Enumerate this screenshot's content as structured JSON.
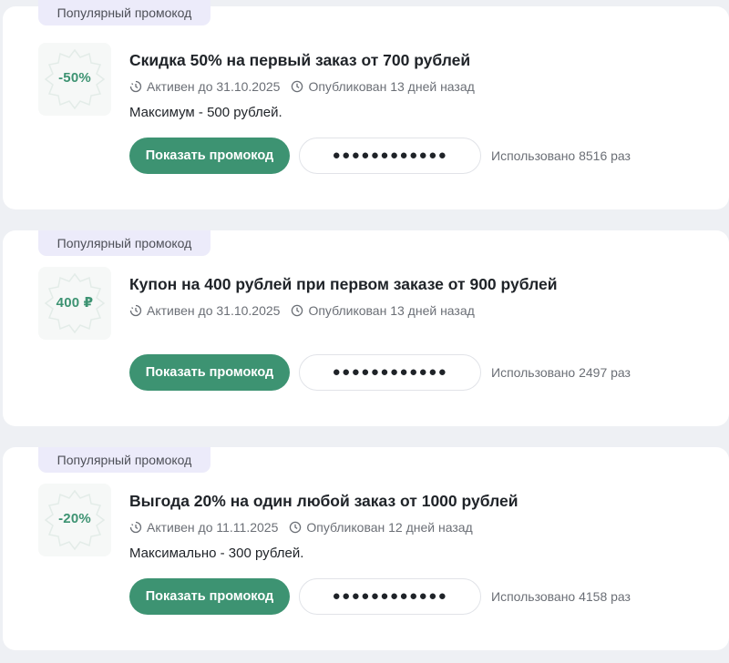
{
  "colors": {
    "accent": "#3d9372",
    "badge_bg": "#ecebfa",
    "page_bg": "#eef0f4"
  },
  "promos": [
    {
      "badge": "Популярный промокод",
      "icon_value": "-50%",
      "title": "Скидка 50% на первый заказ от 700 рублей",
      "active_until": "Активен до 31.10.2025",
      "published": "Опубликован 13 дней назад",
      "note": "Максимум - 500 рублей.",
      "button_label": "Показать промокод",
      "masked_code": "●●●●●●●●●●●●",
      "usage": "Использовано 8516 раз"
    },
    {
      "badge": "Популярный промокод",
      "icon_value": "400 ₽",
      "title": "Купон на 400 рублей при первом заказе от 900 рублей",
      "active_until": "Активен до 31.10.2025",
      "published": "Опубликован 13 дней назад",
      "note": "",
      "button_label": "Показать промокод",
      "masked_code": "●●●●●●●●●●●●",
      "usage": "Использовано 2497 раз"
    },
    {
      "badge": "Популярный промокод",
      "icon_value": "-20%",
      "title": "Выгода 20% на один любой заказ от 1000 рублей",
      "active_until": "Активен до 11.11.2025",
      "published": "Опубликован 12 дней назад",
      "note": "Максимально - 300 рублей.",
      "button_label": "Показать промокод",
      "masked_code": "●●●●●●●●●●●●",
      "usage": "Использовано 4158 раз"
    }
  ]
}
